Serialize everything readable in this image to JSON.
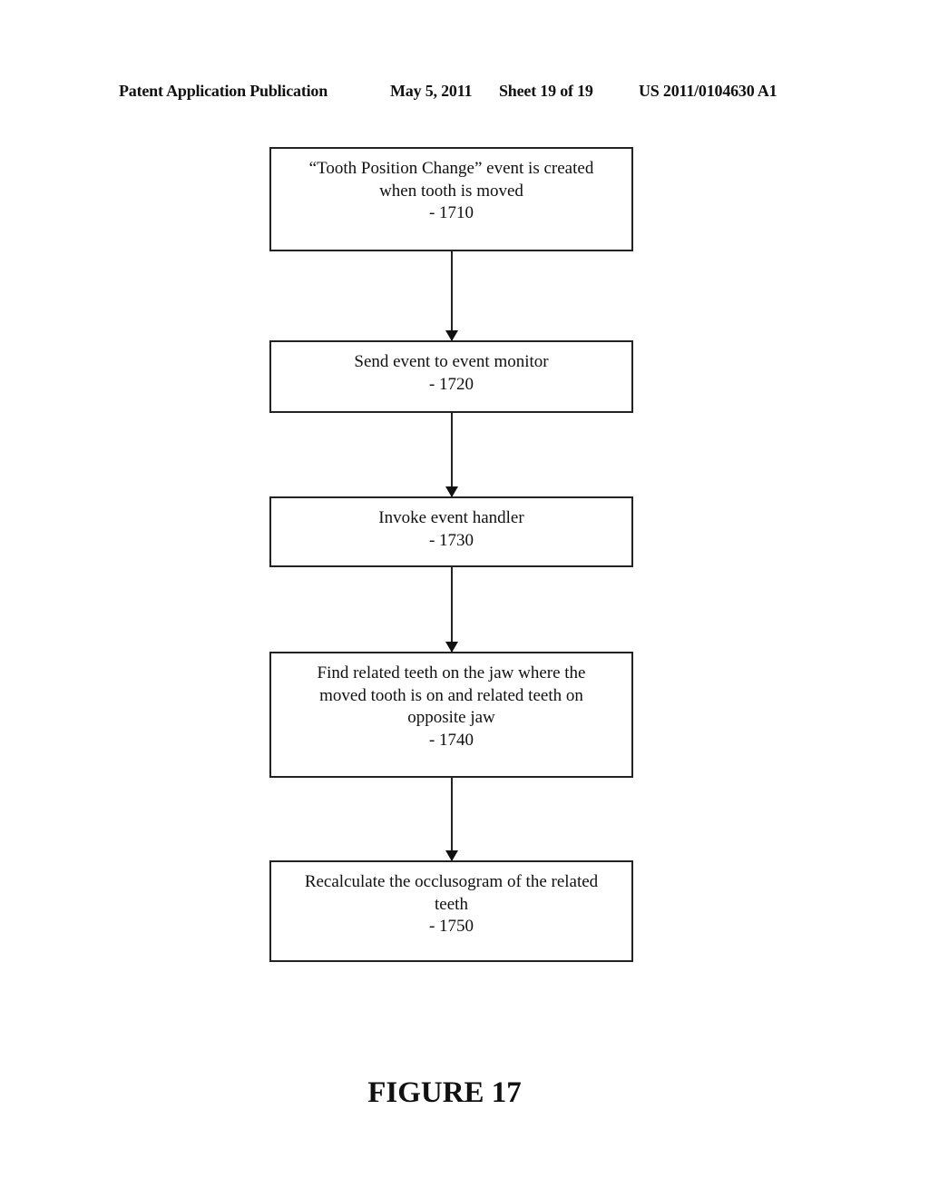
{
  "header": {
    "publication": "Patent Application Publication",
    "date": "May 5, 2011",
    "sheet": "Sheet 19 of 19",
    "number": "US 2011/0104630 A1"
  },
  "flowchart": {
    "steps": [
      {
        "lines": [
          "“Tooth Position Change” event is created",
          "when tooth is moved"
        ],
        "ref": "- 1710"
      },
      {
        "lines": [
          "Send event to event monitor"
        ],
        "ref": "- 1720"
      },
      {
        "lines": [
          "Invoke event handler"
        ],
        "ref": "- 1730"
      },
      {
        "lines": [
          "Find related teeth on the jaw where the",
          "moved tooth is on and related teeth on",
          "opposite jaw"
        ],
        "ref": "- 1740"
      },
      {
        "lines": [
          "Recalculate the occlusogram of the related",
          "teeth"
        ],
        "ref": "- 1750"
      }
    ]
  },
  "figure_label": "FIGURE 17"
}
